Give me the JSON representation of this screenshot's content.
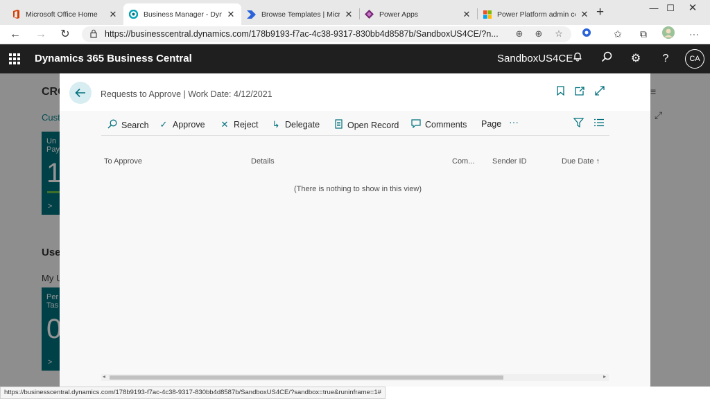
{
  "browser": {
    "tabs": [
      {
        "title": "Microsoft Office Home",
        "icon": "office-icon",
        "active": false
      },
      {
        "title": "Business Manager - Dynam",
        "icon": "dynamics-icon",
        "active": true
      },
      {
        "title": "Browse Templates | Microsc",
        "icon": "power-automate-icon",
        "active": false
      },
      {
        "title": "Power Apps",
        "icon": "power-apps-icon",
        "active": false
      },
      {
        "title": "Power Platform admin cent",
        "icon": "microsoft-logo-icon",
        "active": false
      }
    ],
    "url": "https://businesscentral.dynamics.com/178b9193-f7ac-4c38-9317-830bb4d8587b/SandboxUS4CE/?n...",
    "status_url": "https://businesscentral.dynamics.com/178b9193-f7ac-4c38-9317-830bb4d8587b/SandboxUS4CE/?sandbox=true&runinframe=1#"
  },
  "app": {
    "name": "Dynamics 365 Business Central",
    "environment": "SandboxUS4CE",
    "user_initials": "CA"
  },
  "background": {
    "title": "CRO",
    "link": "Cust",
    "tile1_label_1": "Un",
    "tile1_label_2": "Pay",
    "tile1_value": "1",
    "section": "Use",
    "sub": "My U",
    "tile2_label_1": "Per",
    "tile2_label_2": "Tas",
    "tile2_value": "0"
  },
  "dialog": {
    "title": "Requests to Approve | Work Date: 4/12/2021",
    "actions": {
      "search": "Search",
      "approve": "Approve",
      "reject": "Reject",
      "delegate": "Delegate",
      "open_record": "Open Record",
      "comments": "Comments",
      "page": "Page",
      "more": "···"
    },
    "columns": {
      "to_approve": "To Approve",
      "details": "Details",
      "comments": "Com...",
      "sender_id": "Sender ID",
      "due_date": "Due Date",
      "sort_icon": "↑"
    },
    "empty_message": "(There is nothing to show in this view)"
  },
  "colors": {
    "accent": "#00707c",
    "header_bg": "#201f1f"
  }
}
